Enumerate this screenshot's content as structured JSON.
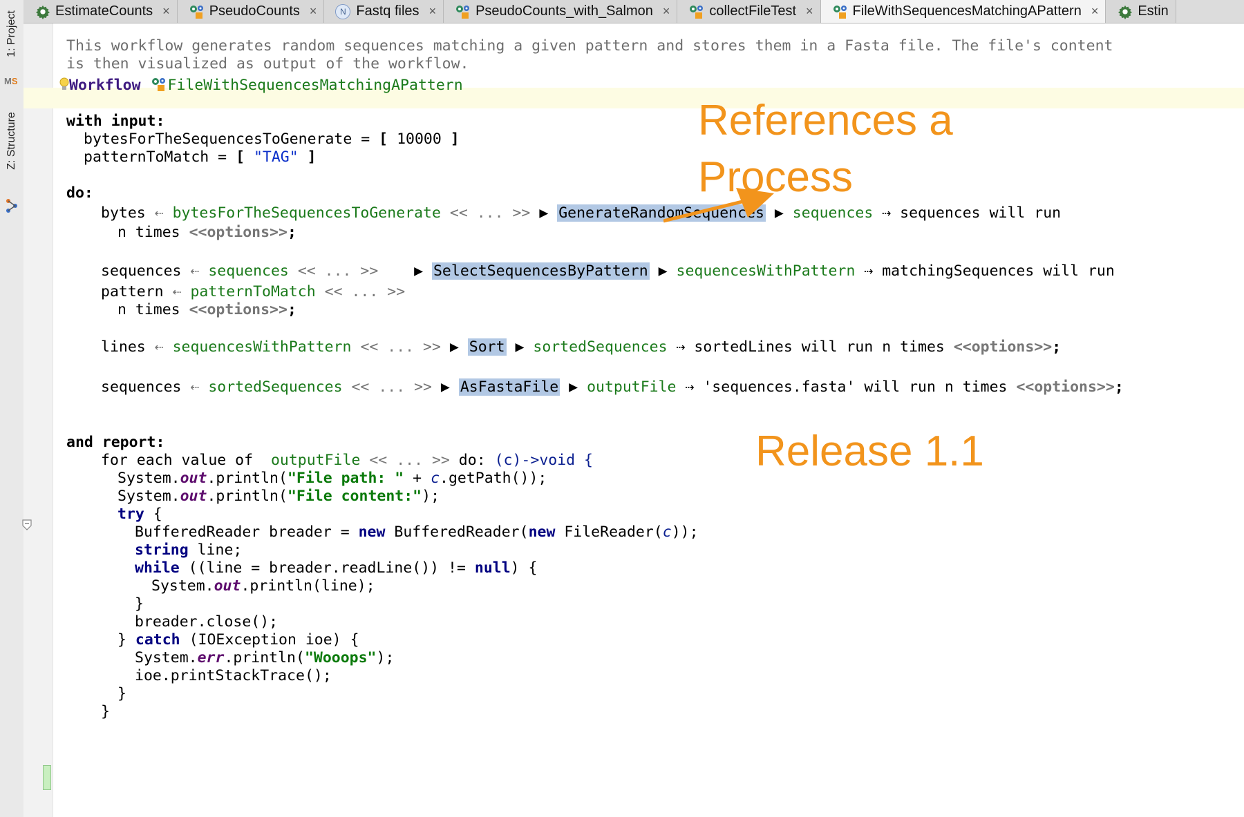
{
  "left_stripe": {
    "project_tab": "1: Project",
    "structure_tab": "Z: Structure",
    "mps_logo": "MPS"
  },
  "tabs": [
    {
      "label": "EstimateCounts",
      "icon": "gear-icon",
      "active": false
    },
    {
      "label": "PseudoCounts",
      "icon": "process-gears-icon",
      "active": false
    },
    {
      "label": "Fastq files",
      "icon": "n-circle-icon",
      "active": false
    },
    {
      "label": "PseudoCounts_with_Salmon",
      "icon": "process-gears-icon",
      "active": false
    },
    {
      "label": "collectFileTest",
      "icon": "process-gears-icon",
      "active": false
    },
    {
      "label": "FileWithSequencesMatchingAPattern",
      "icon": "process-gears-icon",
      "active": true
    },
    {
      "label": "Estin",
      "icon": "gear-icon",
      "active": false
    }
  ],
  "tab_close_glyph": "×",
  "editor": {
    "description_line1": "This workflow generates random sequences matching a given pattern and stores them in a Fasta file. The file's content",
    "description_line2": "is then visualized as output of the workflow.",
    "workflow_keyword": "Workflow",
    "workflow_name": "FileWithSequencesMatchingAPattern",
    "with_input": "with input:",
    "input1_name": "bytesForTheSequencesToGenerate",
    "input1_value": "10000",
    "input2_name": "patternToMatch",
    "input2_value": "\"TAG\"",
    "do_label": "do:",
    "steps": [
      {
        "param": "bytes",
        "src": "bytesForTheSequencesToGenerate",
        "process": "GenerateRandomSequences",
        "output": "sequences",
        "target": "sequences",
        "will_run": "will run",
        "n_times": "n times",
        "options": "<<options>>"
      },
      {
        "param": "sequences",
        "src": "sequences",
        "param2": "pattern",
        "src2": "patternToMatch",
        "process": "SelectSequencesByPattern",
        "output": "sequencesWithPattern",
        "target": "matchingSequences",
        "will_run": "will run",
        "n_times": "n times",
        "options": "<<options>>"
      },
      {
        "param": "lines",
        "src": "sequencesWithPattern",
        "process": "Sort",
        "output": "sortedSequences",
        "target": "sortedLines",
        "will_run": "will run n times",
        "options": "<<options>>"
      },
      {
        "param": "sequences",
        "src": "sortedSequences",
        "process": "AsFastaFile",
        "output": "outputFile",
        "target": "'sequences.fasta'",
        "will_run": "will run n times",
        "options": "<<options>>"
      }
    ],
    "ellipsis_block": "<< ... >>",
    "and_report": "and report:",
    "for_each": "for each value of",
    "for_each_src": "outputFile",
    "lambda": "(c)->void {",
    "java": {
      "file_path_str": "\"File path: \"",
      "file_content_str": "\"File content:\"",
      "wooops_str": "\"Wooops\""
    }
  },
  "annotations": {
    "references": "References a\nProcess",
    "release": "Release 1.1"
  },
  "colors": {
    "annotation": "#f2941c",
    "process_highlight": "#b2c8e4",
    "reference_green": "#1b7a1b"
  }
}
